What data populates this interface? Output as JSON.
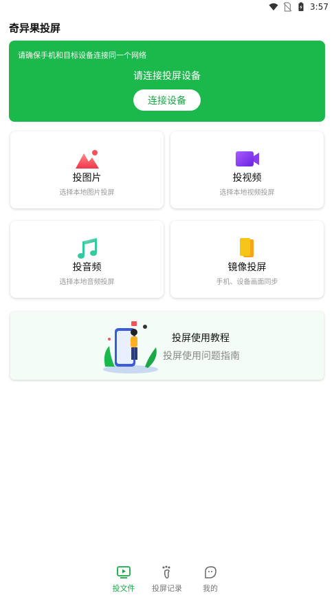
{
  "status": {
    "time": "3:57"
  },
  "app": {
    "title": "奇异果投屏"
  },
  "banner": {
    "hint": "请确保手机和目标设备连接同一个网络",
    "status": "请连接投屏设备",
    "connect_label": "连接设备"
  },
  "cards": {
    "photo": {
      "title": "投图片",
      "subtitle": "选择本地图片投屏"
    },
    "video": {
      "title": "投视频",
      "subtitle": "选择本地视频投屏"
    },
    "audio": {
      "title": "投音频",
      "subtitle": "选择本地音频投屏"
    },
    "mirror": {
      "title": "镜像投屏",
      "subtitle": "手机、设备画面同步"
    }
  },
  "tutorial": {
    "title": "投屏使用教程",
    "subtitle": "投屏使用问题指南"
  },
  "tabs": [
    {
      "label": "投文件",
      "icon": "play-screen-icon",
      "active": true
    },
    {
      "label": "投屏记录",
      "icon": "footprint-icon",
      "active": false
    },
    {
      "label": "我的",
      "icon": "chat-face-icon",
      "active": false
    }
  ],
  "colors": {
    "accent": "#1bb94b",
    "photo": "#f3525a",
    "video": "#8a3cf0",
    "audio": "#35c9a0",
    "mirror": "#f5c518"
  }
}
